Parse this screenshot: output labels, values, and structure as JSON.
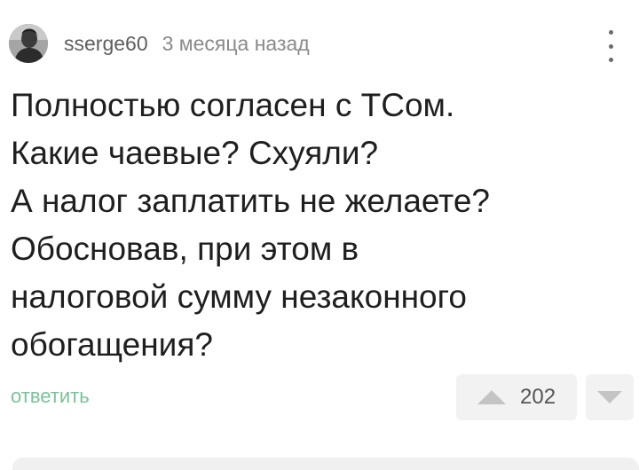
{
  "comment": {
    "author": "sserge60",
    "timestamp": "3 месяца назад",
    "avatar_icon": "user-avatar",
    "menu_icon": "more-vertical-icon",
    "body_lines": [
      "Полностью согласен с ТСом.",
      "Какие чаевые? Схуяли?",
      "А налог заплатить не желаете?",
      "Обосновав, при этом в",
      "налоговой сумму незаконного",
      "обогащения?"
    ],
    "reply_label": "ответить",
    "rating": "202",
    "upvote_icon": "triangle-up-icon",
    "downvote_icon": "triangle-down-icon"
  },
  "colors": {
    "reply_link": "#7cc19a",
    "vote_bg": "#f2f2f2",
    "body_text": "#1f1f1f"
  }
}
